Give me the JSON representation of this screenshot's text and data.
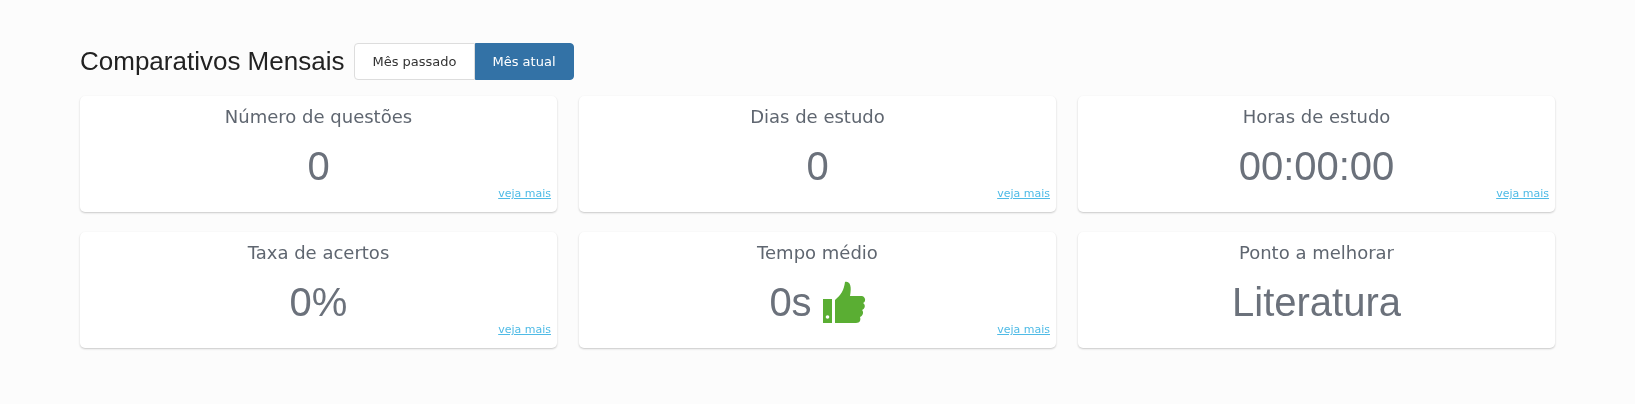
{
  "header": {
    "title": "Comparativos Mensais"
  },
  "period_toggle": [
    {
      "label": "Mês passado",
      "selected": false
    },
    {
      "label": "Mês atual",
      "selected": true
    }
  ],
  "cards": [
    {
      "title": "Número de questões",
      "value": "0",
      "link": "veja mais"
    },
    {
      "title": "Dias de estudo",
      "value": "0",
      "link": "veja mais"
    },
    {
      "title": "Horas de estudo",
      "value": "00:00:00",
      "link": "veja mais"
    },
    {
      "title": "Taxa de acertos",
      "value": "0%",
      "link": "veja mais"
    },
    {
      "title": "Tempo médio",
      "value": "0s",
      "kind": "approved",
      "link": "veja mais"
    },
    {
      "title": "Ponto a melhorar",
      "value": "Literatura"
    }
  ]
}
